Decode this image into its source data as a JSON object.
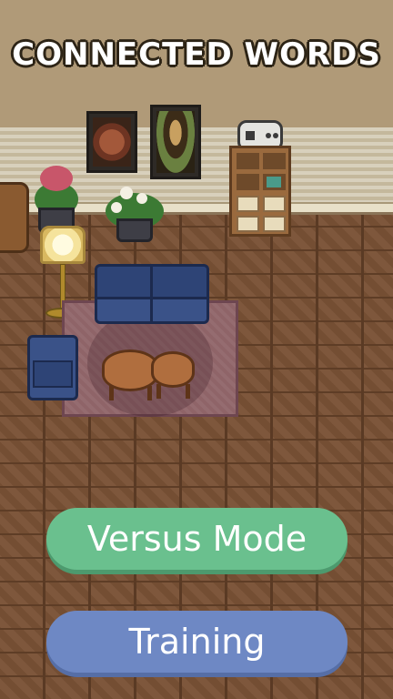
{
  "title": "CONNECTED WORDS",
  "buttons": {
    "versus_label": "Versus Mode",
    "training_label": "Training"
  },
  "colors": {
    "versus": "#6ac08e",
    "training": "#6e88c4",
    "title_text": "#ffffff",
    "wall": "#b09a78",
    "floor": "#7a5236"
  }
}
